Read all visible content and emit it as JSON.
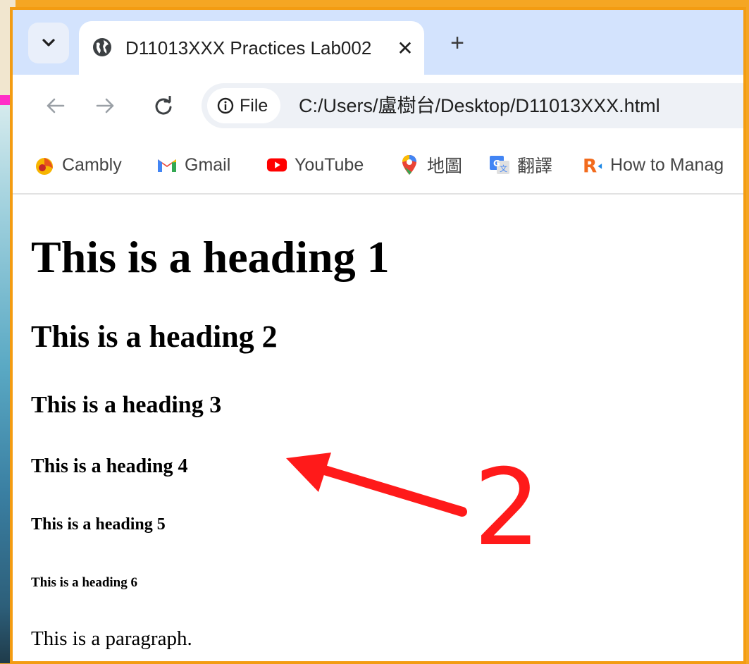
{
  "tab": {
    "title": "D11013XXX Practices Lab002",
    "close_glyph": "✕",
    "new_tab_glyph": "+"
  },
  "toolbar": {
    "file_label": "File",
    "url": "C:/Users/盧樹台/Desktop/D11013XXX.html"
  },
  "bookmarks": [
    {
      "label": "Cambly",
      "icon": "cambly-icon"
    },
    {
      "label": "Gmail",
      "icon": "gmail-icon"
    },
    {
      "label": "YouTube",
      "icon": "youtube-icon"
    },
    {
      "label": "地圖",
      "icon": "maps-icon"
    },
    {
      "label": "翻譯",
      "icon": "translate-icon"
    },
    {
      "label": "How to Manag",
      "icon": "r-icon"
    }
  ],
  "page": {
    "h1": "This is a heading 1",
    "h2": "This is a heading 2",
    "h3": "This is a heading 3",
    "h4": "This is a heading 4",
    "h5": "This is a heading 5",
    "h6": "This is a heading 6",
    "paragraph": "This is a paragraph."
  },
  "annotation": {
    "number": "2",
    "color": "#ff1a1a"
  },
  "colors": {
    "frame_border": "#f39c12",
    "tabbar_bg": "#d3e3fd"
  }
}
